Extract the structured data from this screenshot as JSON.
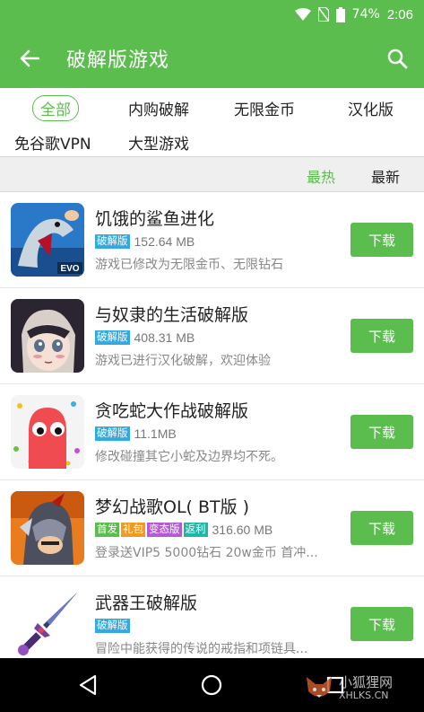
{
  "status": {
    "battery": "74%",
    "time": "2:06"
  },
  "header": {
    "title": "破解版游戏",
    "back_icon": "arrow-left-icon",
    "search_icon": "search-icon"
  },
  "filters": [
    "全部",
    "内购破解",
    "无限金币",
    "汉化版",
    "免谷歌VPN",
    "大型游戏"
  ],
  "sort": {
    "hot": "最热",
    "new": "最新"
  },
  "apps": [
    {
      "title": "饥饿的鲨鱼进化",
      "badges": [
        {
          "text": "破解版",
          "color": "#33a9e0"
        }
      ],
      "size": "152.64 MB",
      "desc": "游戏已修改为无限金币、无限钻石",
      "button": "下载"
    },
    {
      "title": "与奴隶的生活破解版",
      "badges": [
        {
          "text": "破解版",
          "color": "#33a9e0"
        }
      ],
      "size": "408.31 MB",
      "desc": "游戏已进行汉化破解，欢迎体验",
      "button": "下载"
    },
    {
      "title": "贪吃蛇大作战破解版",
      "badges": [
        {
          "text": "破解版",
          "color": "#33a9e0"
        }
      ],
      "size": "11.1MB",
      "desc": "修改碰撞其它小蛇及边界均不死。",
      "button": "下载"
    },
    {
      "title": "梦幻战歌OL( BT版 )",
      "badges": [
        {
          "text": "首发",
          "color": "#5cbd4f"
        },
        {
          "text": "礼包",
          "color": "#f39a1e"
        },
        {
          "text": "变态版",
          "color": "#b35ad6"
        },
        {
          "text": "返利",
          "color": "#1fb6a8"
        }
      ],
      "size": "316.60 MB",
      "desc": "登录送VIP5 5000钻石 20w金币 首冲...",
      "button": "下载"
    },
    {
      "title": "武器王破解版",
      "badges": [
        {
          "text": "破解版",
          "color": "#33a9e0"
        }
      ],
      "size": "",
      "desc": "冒险中能获得的传说的戒指和项链具...",
      "button": "下载"
    }
  ],
  "watermark": {
    "line1": "小狐狸网",
    "line2": "XHLKS.CN"
  }
}
